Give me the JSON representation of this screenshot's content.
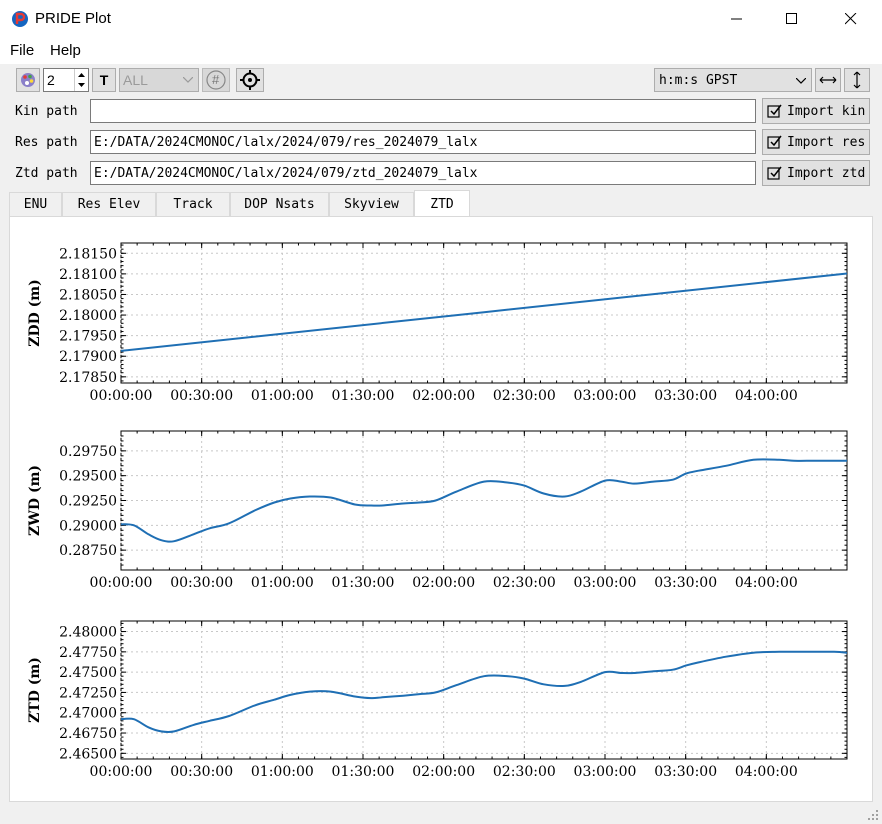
{
  "window": {
    "title": "PRIDE Plot"
  },
  "menu": {
    "file": "File",
    "help": "Help"
  },
  "toolbar": {
    "spin_value": "2",
    "text_button": "T",
    "satellite_combo": "ALL",
    "hash_button": "#",
    "time_combo": "h:m:s GPST"
  },
  "paths": [
    {
      "label": "Kin path",
      "value": "",
      "button": "Import kin"
    },
    {
      "label": "Res path",
      "value": "E:/DATA/2024CMONOC/lalx/2024/079/res_2024079_lalx",
      "button": "Import res"
    },
    {
      "label": "Ztd path",
      "value": "E:/DATA/2024CMONOC/lalx/2024/079/ztd_2024079_lalx",
      "button": "Import ztd"
    }
  ],
  "tabs": [
    "ENU",
    "Res Elev",
    "Track",
    "DOP Nsats",
    "Skyview",
    "ZTD"
  ],
  "active_tab": "ZTD",
  "colors": {
    "series": "#1f6fb4",
    "accent": "#0078d7"
  },
  "chart_data": [
    {
      "type": "line",
      "ylabel": "ZDD (m)",
      "x_ticks": [
        "00:00:00",
        "00:30:00",
        "01:00:00",
        "01:30:00",
        "02:00:00",
        "02:30:00",
        "03:00:00",
        "03:30:00",
        "04:00:00"
      ],
      "xlim_hours": [
        0,
        4.5
      ],
      "y_ticks": [
        "2.18150",
        "2.18100",
        "2.18050",
        "2.18000",
        "2.17950",
        "2.17900",
        "2.17850"
      ],
      "ylim": [
        2.17835,
        2.18175
      ],
      "grid": true,
      "series": [
        {
          "x_hours": [
            0,
            4.5
          ],
          "values": [
            2.17913,
            2.18101
          ]
        }
      ]
    },
    {
      "type": "line",
      "ylabel": "ZWD (m)",
      "x_ticks": [
        "00:00:00",
        "00:30:00",
        "01:00:00",
        "01:30:00",
        "02:00:00",
        "02:30:00",
        "03:00:00",
        "03:30:00",
        "04:00:00"
      ],
      "xlim_hours": [
        0,
        4.5
      ],
      "y_ticks": [
        "0.29750",
        "0.29500",
        "0.29250",
        "0.29000",
        "0.28750"
      ],
      "ylim": [
        0.2855,
        0.2995
      ],
      "grid": true,
      "series": [
        {
          "x_hours": [
            0,
            0.08,
            0.17,
            0.25,
            0.33,
            0.45,
            0.55,
            0.67,
            0.83,
            0.95,
            1.05,
            1.17,
            1.3,
            1.45,
            1.55,
            1.62,
            1.75,
            1.85,
            1.95,
            2.08,
            2.25,
            2.4,
            2.5,
            2.62,
            2.75,
            2.85,
            3.0,
            3.1,
            3.18,
            3.3,
            3.42,
            3.5,
            3.58,
            3.75,
            3.92,
            4.08,
            4.17,
            4.25,
            4.42,
            4.5
          ],
          "values": [
            0.2901,
            0.29,
            0.2891,
            0.2885,
            0.2884,
            0.2891,
            0.2897,
            0.2902,
            0.2915,
            0.2923,
            0.2927,
            0.2929,
            0.2928,
            0.2921,
            0.292,
            0.292,
            0.2922,
            0.2923,
            0.2925,
            0.2934,
            0.2944,
            0.2943,
            0.294,
            0.2932,
            0.2929,
            0.2934,
            0.2945,
            0.2944,
            0.2942,
            0.2944,
            0.2946,
            0.2952,
            0.2955,
            0.296,
            0.2966,
            0.2966,
            0.2965,
            0.2965,
            0.2965,
            0.2965
          ]
        }
      ]
    },
    {
      "type": "line",
      "ylabel": "ZTD (m)",
      "x_ticks": [
        "00:00:00",
        "00:30:00",
        "01:00:00",
        "01:30:00",
        "02:00:00",
        "02:30:00",
        "03:00:00",
        "03:30:00",
        "04:00:00"
      ],
      "xlim_hours": [
        0,
        4.5
      ],
      "y_ticks": [
        "2.48000",
        "2.47750",
        "2.47500",
        "2.47250",
        "2.47000",
        "2.46750",
        "2.46500"
      ],
      "ylim": [
        2.4643,
        2.4813
      ],
      "grid": true,
      "series": [
        {
          "x_hours": [
            0,
            0.08,
            0.17,
            0.25,
            0.33,
            0.45,
            0.55,
            0.67,
            0.83,
            0.95,
            1.05,
            1.17,
            1.3,
            1.45,
            1.55,
            1.62,
            1.75,
            1.85,
            1.95,
            2.08,
            2.25,
            2.4,
            2.5,
            2.62,
            2.75,
            2.85,
            3.0,
            3.1,
            3.18,
            3.3,
            3.42,
            3.5,
            3.58,
            3.75,
            3.92,
            4.08,
            4.17,
            4.25,
            4.42,
            4.5
          ],
          "values": [
            2.4692,
            2.4692,
            2.4682,
            2.4677,
            2.4677,
            2.4685,
            2.469,
            2.4696,
            2.4709,
            2.4716,
            2.4722,
            2.4726,
            2.4726,
            2.472,
            2.4718,
            2.4719,
            2.4721,
            2.4723,
            2.4725,
            2.4734,
            2.4745,
            2.4745,
            2.4742,
            2.4735,
            2.4733,
            2.4738,
            2.475,
            2.4749,
            2.4749,
            2.4751,
            2.4753,
            2.4758,
            2.4762,
            2.4769,
            2.4774,
            2.4775,
            2.4775,
            2.4775,
            2.4775,
            2.4774
          ]
        }
      ]
    }
  ]
}
